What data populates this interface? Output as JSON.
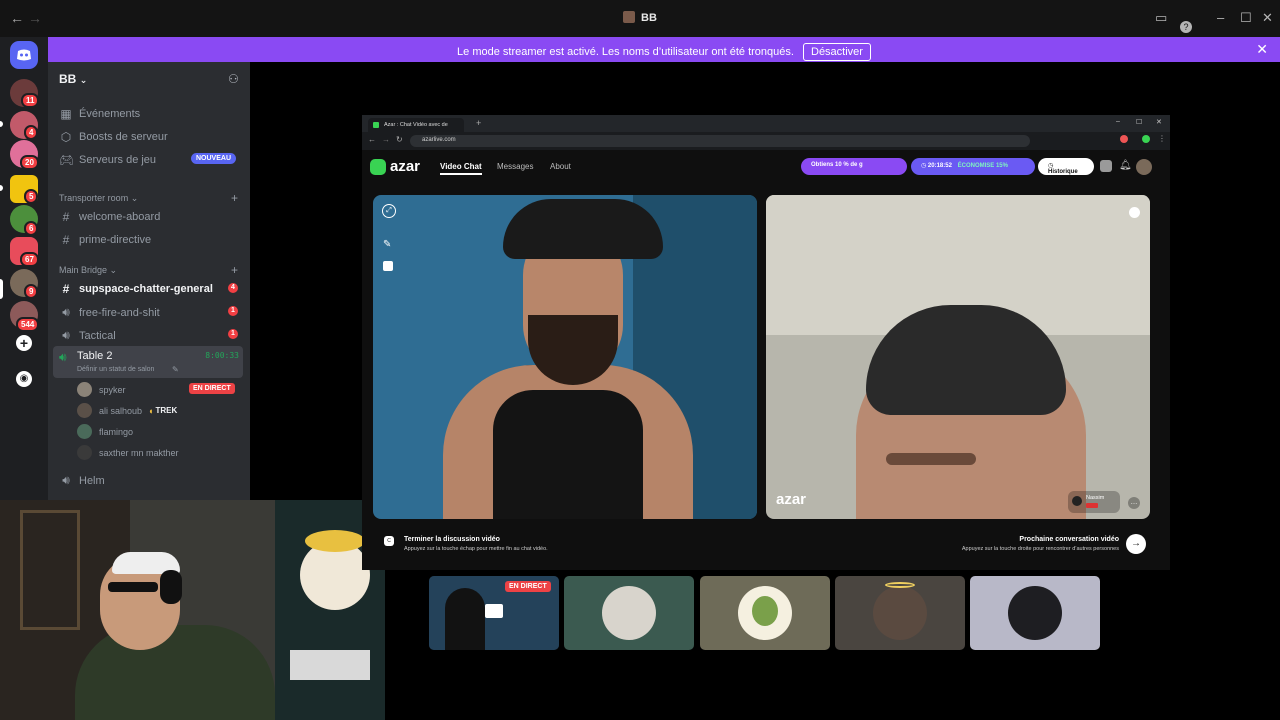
{
  "window": {
    "title": "BB",
    "back_icon": "arrow-left-icon",
    "forward_icon": "arrow-right-icon"
  },
  "banner": {
    "message": "Le mode streamer est activé. Les noms d’utilisateur ont été tronqués.",
    "button": "Désactiver"
  },
  "server_rail": {
    "badges": [
      "11",
      "4",
      "20",
      "5",
      "6",
      "67",
      "9",
      "544"
    ]
  },
  "sidebar": {
    "guild_name": "BB",
    "items": [
      {
        "icon": "calendar-icon",
        "label": "Événements"
      },
      {
        "icon": "boost-icon",
        "label": "Boosts de serveur"
      },
      {
        "icon": "gamepad-icon",
        "label": "Serveurs de jeu",
        "badge": "NOUVEAU"
      }
    ],
    "category1": "Transporter room",
    "channels1": [
      "welcome-aboard",
      "prime-directive"
    ],
    "category2": "Main Bridge",
    "channels2": [
      {
        "name": "supspace-chatter-general",
        "type": "text",
        "badge": "4"
      },
      {
        "name": "free-fire-and-shit",
        "type": "voice",
        "badge": "1"
      },
      {
        "name": "Tactical",
        "type": "voice",
        "badge": "1"
      }
    ],
    "voice_channel": {
      "name": "Table 2",
      "timer": "8:00:33",
      "status": "Définir un statut de salon",
      "users": [
        {
          "name": "spyker",
          "live": "EN DIRECT"
        },
        {
          "name": "ali salhoub",
          "tag": "TREK"
        },
        {
          "name": "flamingo"
        },
        {
          "name": "saxther mn makther"
        }
      ]
    },
    "last_channel": "Helm"
  },
  "browser": {
    "tab_title": "Azar : Chat Vidéo avec de",
    "url": "azarlive.com",
    "logo": "azar",
    "nav": [
      "Video Chat",
      "Messages",
      "About"
    ],
    "promo": "Obtiens 10 % de g",
    "timer": "20:18:52",
    "economy": "ÉCONOMISE 15%",
    "history": "Historique",
    "watermark": "azar",
    "remote_user": "Nassim",
    "end_title": "Terminer la discussion vidéo",
    "end_sub": "Appuyez sur la touche échap pour mettre fin au chat vidéo.",
    "next_title": "Prochaine conversation vidéo",
    "next_sub": "Appuyez sur la touche droite pour rencontrer d’autres personnes",
    "esc_label": "C"
  },
  "tiles": {
    "live_label": "EN DIRECT"
  },
  "colors": {
    "accent": "#8a4af3",
    "discord_bg": "#2b2d31",
    "rail_bg": "#1e1f22",
    "live_red": "#ed4245",
    "azar_green": "#39d353"
  }
}
